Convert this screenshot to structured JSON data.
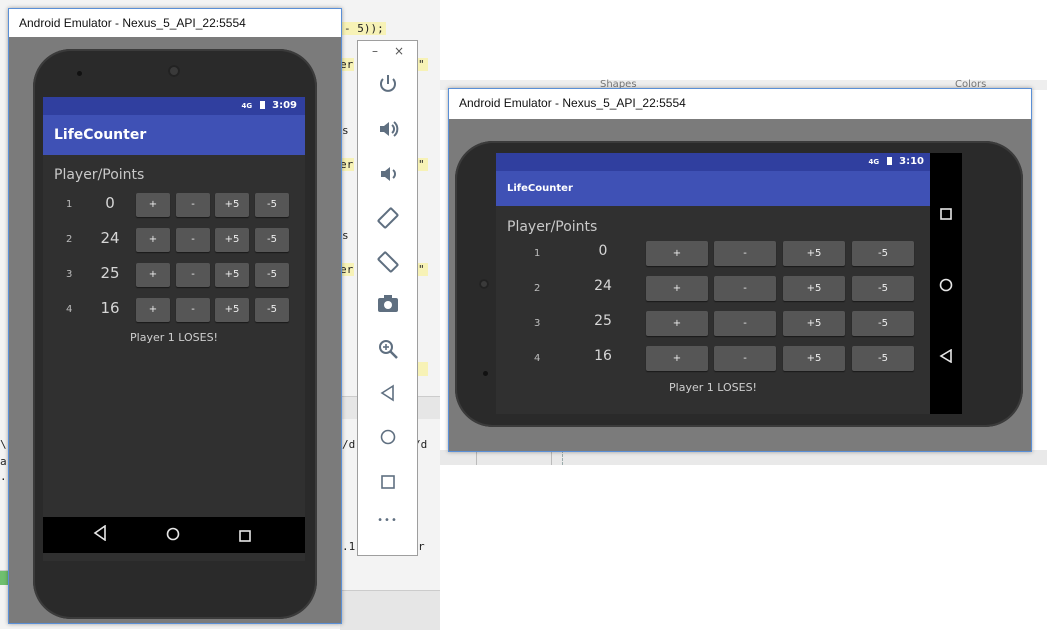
{
  "ide": {
    "code_line": "- 5));",
    "fragment_er": "er",
    "fragment_quote": "\"",
    "fragment_s": "s",
    "fragment_slash": "/d",
    "fragment_path": ".1",
    "fragment_r": "r",
    "fragment_backslash": "\\",
    "fragment_a": "a",
    "fragment_dot": ".",
    "panel_shapes": "Shapes",
    "panel_colors": "Colors"
  },
  "portrait_window": {
    "title": "Android Emulator - Nexus_5_API_22:5554",
    "status": {
      "network": "4G",
      "time": "3:09"
    },
    "app_title": "LifeCounter",
    "heading": "Player/Points",
    "rows": [
      {
        "player": "1",
        "points": "0"
      },
      {
        "player": "2",
        "points": "24"
      },
      {
        "player": "3",
        "points": "25"
      },
      {
        "player": "4",
        "points": "16"
      }
    ],
    "buttons": [
      "+",
      "-",
      "+5",
      "-5"
    ],
    "message": "Player 1 LOSES!"
  },
  "landscape_window": {
    "title": "Android Emulator - Nexus_5_API_22:5554",
    "status": {
      "network": "4G",
      "time": "3:10"
    },
    "app_title": "LifeCounter",
    "heading": "Player/Points",
    "rows": [
      {
        "player": "1",
        "points": "0"
      },
      {
        "player": "2",
        "points": "24"
      },
      {
        "player": "3",
        "points": "25"
      },
      {
        "player": "4",
        "points": "16"
      }
    ],
    "buttons": [
      "+",
      "-",
      "+5",
      "-5"
    ],
    "message": "Player 1 LOSES!"
  },
  "emulator_toolbar": {
    "minimize": "–",
    "close": "×",
    "more": "•••"
  },
  "colors": {
    "status_bar": "#303f9f",
    "app_bar": "#3f51b5",
    "screen_bg": "#303030",
    "button_bg": "#565656"
  }
}
